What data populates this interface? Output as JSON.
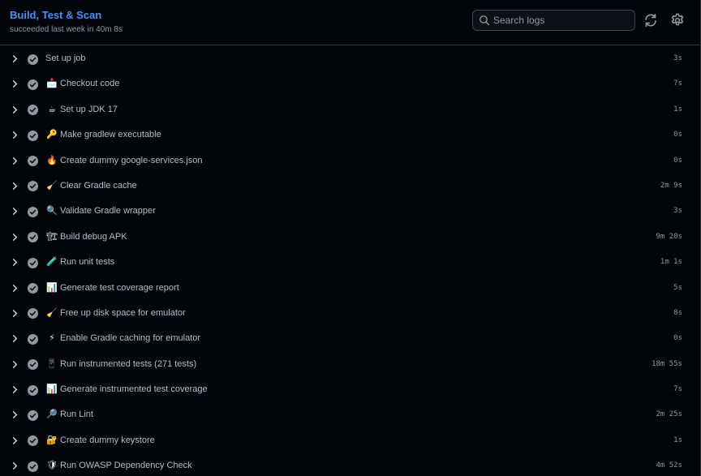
{
  "header": {
    "title": "Build, Test & Scan",
    "subtitle": "succeeded last week in 40m 8s"
  },
  "search": {
    "placeholder": "Search logs",
    "value": ""
  },
  "icons": {
    "search": "search-icon",
    "refresh": "refresh-icon",
    "settings": "gear-icon",
    "expand": "chevron-right-icon",
    "status_success": "check-circle-icon"
  },
  "colors": {
    "title": "#4493f8",
    "status_success": "#9198a1",
    "background": "#010409"
  },
  "steps": [
    {
      "emoji": "",
      "name": "Set up job",
      "duration": "3s",
      "status": "success"
    },
    {
      "emoji": "📩",
      "name": "Checkout code",
      "duration": "7s",
      "status": "success"
    },
    {
      "emoji": "☕",
      "name": "Set up JDK 17",
      "duration": "1s",
      "status": "success"
    },
    {
      "emoji": "🔑",
      "name": "Make gradlew executable",
      "duration": "0s",
      "status": "success"
    },
    {
      "emoji": "🔥",
      "name": "Create dummy google-services.json",
      "duration": "0s",
      "status": "success"
    },
    {
      "emoji": "🧹",
      "name": "Clear Gradle cache",
      "duration": "2m 9s",
      "status": "success"
    },
    {
      "emoji": "🔍",
      "name": "Validate Gradle wrapper",
      "duration": "3s",
      "status": "success"
    },
    {
      "emoji": "🏗",
      "name": "Build debug APK",
      "duration": "9m 20s",
      "status": "success"
    },
    {
      "emoji": "🧪",
      "name": "Run unit tests",
      "duration": "1m 1s",
      "status": "success"
    },
    {
      "emoji": "📊",
      "name": "Generate test coverage report",
      "duration": "5s",
      "status": "success"
    },
    {
      "emoji": "🧹",
      "name": "Free up disk space for emulator",
      "duration": "8s",
      "status": "success"
    },
    {
      "emoji": "⚡",
      "name": "Enable Gradle caching for emulator",
      "duration": "0s",
      "status": "success"
    },
    {
      "emoji": "📱",
      "name": "Run instrumented tests (271 tests)",
      "duration": "18m 55s",
      "status": "success"
    },
    {
      "emoji": "📊",
      "name": "Generate instrumented test coverage",
      "duration": "7s",
      "status": "success"
    },
    {
      "emoji": "🔎",
      "name": "Run Lint",
      "duration": "2m 25s",
      "status": "success"
    },
    {
      "emoji": "🔐",
      "name": "Create dummy keystore",
      "duration": "1s",
      "status": "success"
    },
    {
      "emoji": "🛡",
      "name": "Run OWASP Dependency Check",
      "duration": "4m 52s",
      "status": "success"
    }
  ]
}
